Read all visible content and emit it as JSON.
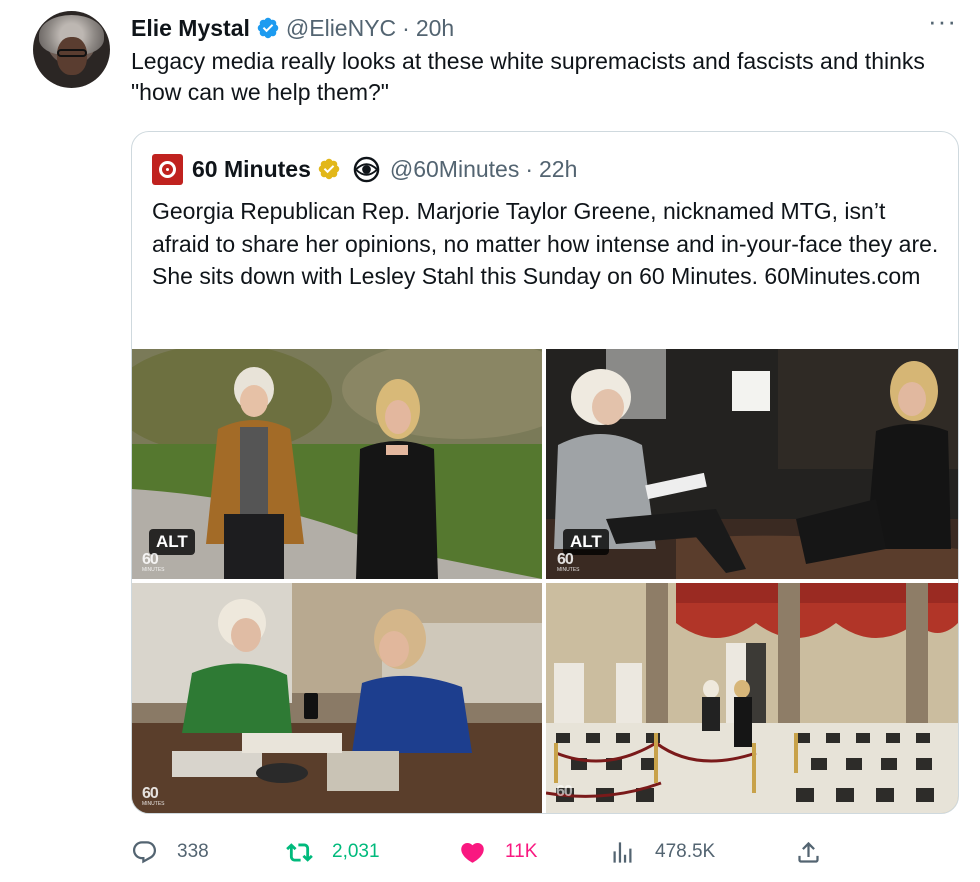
{
  "tweet": {
    "display_name": "Elie Mystal",
    "handle": "@ElieNYC",
    "separator": "·",
    "time": "20h",
    "more": "···",
    "text": "Legacy media really looks at these white supremacists and fascists and thinks \"how can we help them?\""
  },
  "quote": {
    "display_name": "60 Minutes",
    "handle": "@60Minutes",
    "separator": "·",
    "time": "22h",
    "text": "Georgia Republican Rep. Marjorie Taylor Greene, nicknamed MTG, isn’t afraid to share her opinions, no matter how intense and in-your-face they are. She sits down with Lesley Stahl this Sunday on 60 Minutes. 60Minutes.com",
    "media": [
      {
        "alt_badge": "ALT",
        "watermark": "60",
        "watermark_sub": "MINUTES"
      },
      {
        "alt_badge": "ALT",
        "watermark": "60",
        "watermark_sub": "MINUTES"
      },
      {
        "watermark": "60",
        "watermark_sub": "MINUTES"
      },
      {
        "watermark": "60"
      }
    ]
  },
  "actions": {
    "replies": "338",
    "retweets": "2,031",
    "likes": "11K",
    "views": "478.5K"
  },
  "colors": {
    "verified_blue": "#1d9bf0",
    "verified_gold": "#e2b719",
    "retweet_green": "#00ba7c",
    "like_pink": "#f91880",
    "secondary_text": "#536471",
    "border": "#cfd9de"
  },
  "icons": [
    "verified-badge-icon",
    "more-icon",
    "gold-check-icon",
    "cbs-eye-icon",
    "reply-icon",
    "retweet-icon",
    "like-icon",
    "views-icon",
    "share-icon"
  ]
}
